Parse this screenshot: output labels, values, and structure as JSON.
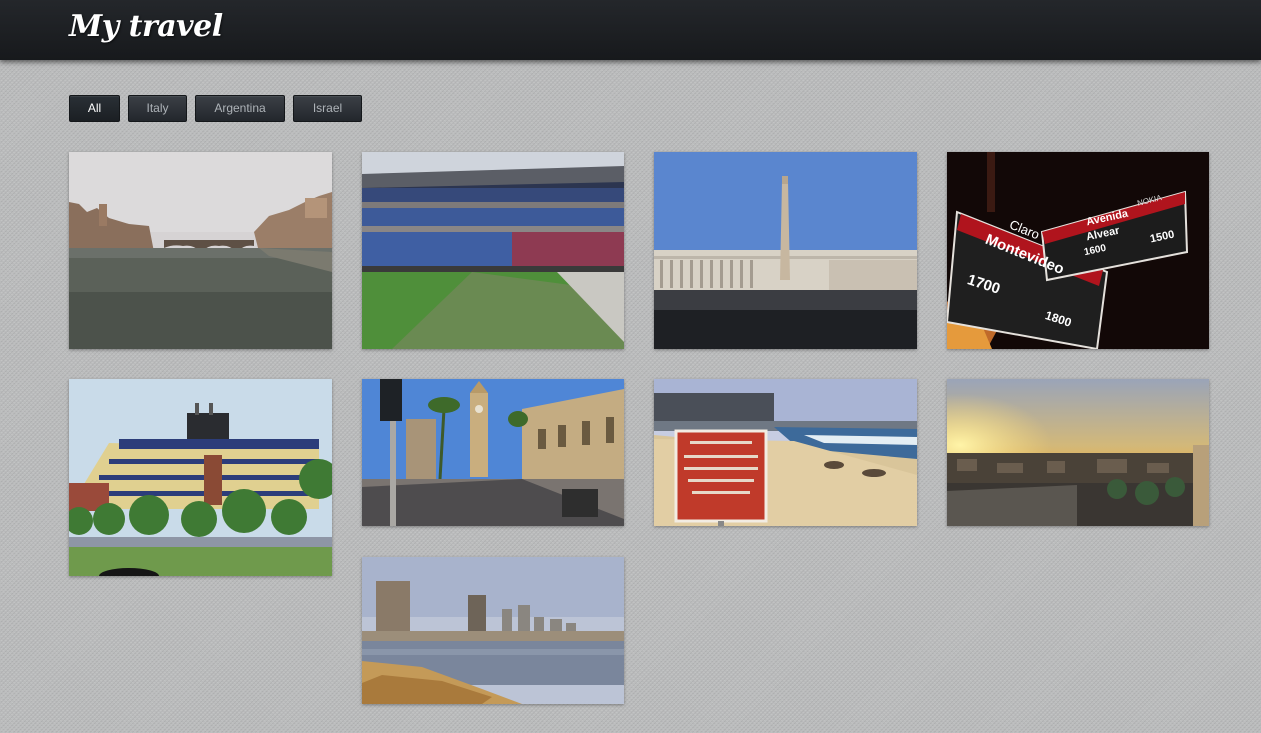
{
  "header": {
    "title": "My travel"
  },
  "filters": [
    {
      "label": "All",
      "active": true
    },
    {
      "label": "Italy",
      "active": false
    },
    {
      "label": "Argentina",
      "active": false
    },
    {
      "label": "Israel",
      "active": false
    }
  ],
  "photos": [
    {
      "subject": "arno-river-bridge"
    },
    {
      "subject": "football-stadium-interior"
    },
    {
      "subject": "st-peters-square-obelisk"
    },
    {
      "subject": "night-street-sign",
      "sign": {
        "brand": "Claro",
        "brand2": "NOKIA",
        "street_main": "Montevideo",
        "num_left": "1700",
        "num_right": "1800",
        "street2_line1": "Avenida",
        "street2_line2": "Alvear",
        "num2_left": "1600",
        "num2_right": "1500"
      }
    },
    {
      "subject": "stadium-exterior-park"
    },
    {
      "subject": "clock-tower-street"
    },
    {
      "subject": "beach-warning-sign"
    },
    {
      "subject": "sunset-city-rooftops"
    },
    {
      "subject": "seaside-city-skyline"
    }
  ]
}
